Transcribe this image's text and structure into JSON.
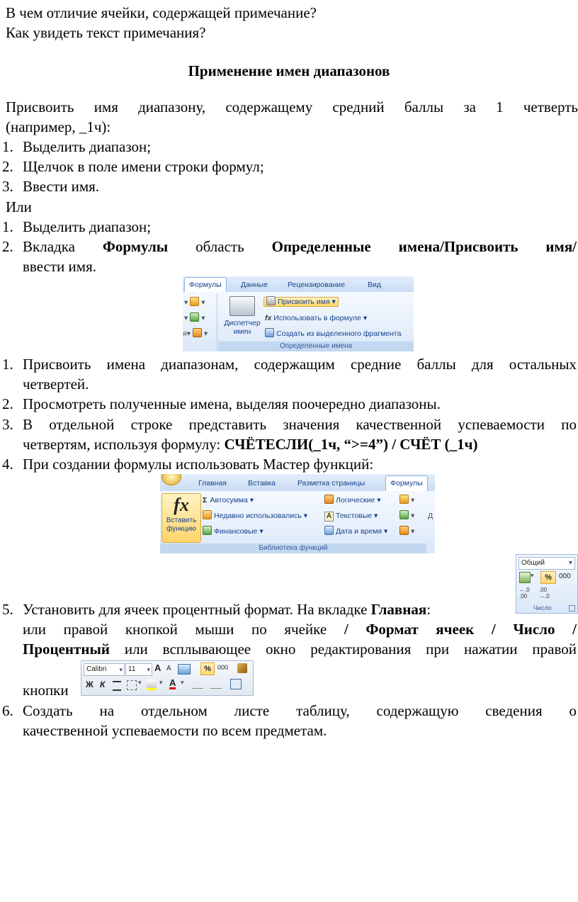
{
  "lines": {
    "q1": "В чем отличие ячейки, содержащей примечание?",
    "q2": "Как увидеть текст примечания?",
    "title": "Применение имен диапазонов",
    "intro1": "Присвоить имя диапазону, содержащему средний баллы за 1 четверть",
    "intro2": "(например, _1ч):",
    "or": "Или"
  },
  "list1": [
    {
      "n": "1.",
      "t": "Выделить диапазон;"
    },
    {
      "n": "2.",
      "t": "Щелчок в поле имени строки формул;"
    },
    {
      "n": "3.",
      "t": "Ввести имя."
    }
  ],
  "list2": {
    "i1_n": "1.",
    "i1": "Выделить диапазон;",
    "i2_n": "2.",
    "i2_pre": "Вкладка",
    "i2_b1": "Формулы",
    "i2_mid": "область",
    "i2_b2": "Определенные имена/Присвоить имя/",
    "i2_line2": "ввести имя."
  },
  "ribbon1": {
    "tabs": [
      "Формулы",
      "Данные",
      "Рецензирование",
      "Вид"
    ],
    "manager_label_1": "Диспетчер",
    "manager_label_2": "имен",
    "assign_name": "Присвоить имя",
    "use_in_formula": "Использовать в формуле",
    "create_from_selection": "Создать из выделенного фрагмента",
    "group_label": "Определенные имена",
    "edge_char": "я"
  },
  "list3": [
    {
      "n": "1.",
      "t": "Присвоить имена диапазонам, содержащим средние баллы для остальных",
      "t2": "четвертей."
    },
    {
      "n": "2.",
      "t": "Просмотреть полученные имена, выделяя поочередно диапазоны."
    },
    {
      "n": "3.",
      "t": "В отдельной строке представить значения качественной успеваемости по",
      "t2a": "четвертям, используя формулу: ",
      "t2b": "СЧЁТЕСЛИ(_1ч, “>=4”) / СЧЁТ (_1ч)"
    },
    {
      "n": "4.",
      "t": "При создании формулы использовать Мастер функций:"
    }
  ],
  "ribbon2": {
    "tabs": [
      "Главная",
      "Вставка",
      "Разметка страницы",
      "Формулы"
    ],
    "fx_glyph": "fx",
    "insert_fn_1": "Вставить",
    "insert_fn_2": "функцию",
    "autosum": "Автосумма",
    "recent": "Недавно использовались",
    "financial": "Финансовые",
    "logical": "Логические",
    "text": "Текстовые",
    "datetime": "Дата и время",
    "group_label": "Библиотека функций",
    "sigma": "Σ",
    "edge_char": "Д"
  },
  "numgroup": {
    "format": "Общий",
    "percent": "%",
    "thousands": "000",
    "inc": "←,0 ,00",
    "dec": ",00 →,0",
    "label": "Число"
  },
  "item5": {
    "n": "5.",
    "pre": "Установить для ячеек процентный формат. На вкладке ",
    "b1": "Главная",
    "post": ":",
    "l2a": "или правой кнопкой мыши по ячейке ",
    "l2b": "/ Формат ячеек / Число /",
    "l3b": "Процентный",
    "l3a": " или всплывающее окно редактирования при нажатии правой",
    "l4": "кнопки"
  },
  "minitoolbar": {
    "font": "Calibri",
    "size": "11",
    "bold": "Ж",
    "italic": "К",
    "percent": "%",
    "thousands": "000",
    "grow": "A",
    "shrink": "A"
  },
  "item6": {
    "n": "6.",
    "t": "Создать на отдельном листе таблицу, содержащую сведения о",
    "t2": "качественной успеваемости по всем предметам."
  }
}
